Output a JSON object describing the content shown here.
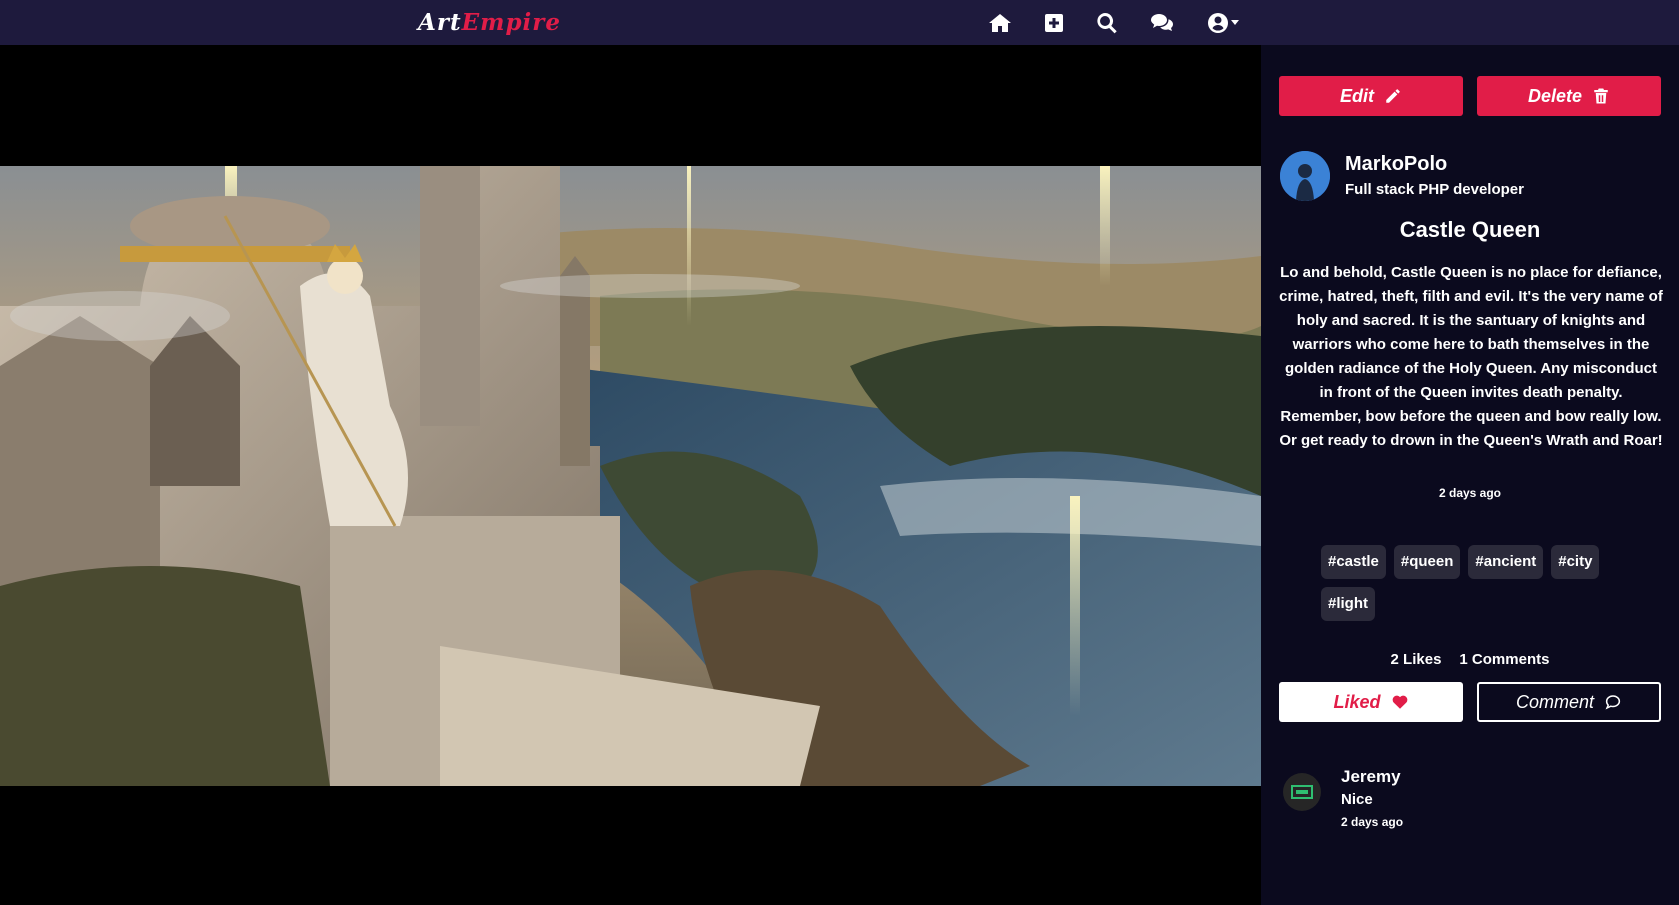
{
  "brand": {
    "part1": "Art",
    "part2": "Empire"
  },
  "nav": {
    "icons": [
      "home-icon",
      "add-post-icon",
      "search-icon",
      "chat-icon",
      "user-menu-icon"
    ]
  },
  "actions": {
    "edit_label": "Edit",
    "delete_label": "Delete"
  },
  "author": {
    "name": "MarkoPolo",
    "bio": "Full stack PHP developer"
  },
  "post": {
    "title": "Castle Queen",
    "description": "Lo and behold, Castle Queen is no place for defiance, crime, hatred, theft, filth and evil. It's the very name of holy and sacred. It is the santuary of knights and warriors who come here to bath themselves in the golden radiance of the Holy Queen. Any misconduct in front of the Queen invites death penalty. Remember, bow before the queen and bow really low. Or get ready to drown in the Queen's Wrath and Roar!",
    "time": "2 days ago",
    "tags": [
      "#castle",
      "#queen",
      "#ancient",
      "#city",
      "#light"
    ],
    "likes": "2 Likes",
    "comments": "1 Comments",
    "liked_label": "Liked",
    "comment_label": "Comment"
  },
  "comment": {
    "author": "Jeremy",
    "text": "Nice",
    "time": "2 days ago"
  },
  "colors": {
    "accent": "#e11d48",
    "navbar": "#1e1a3d",
    "panel": "#0b0a1e",
    "tag_bg": "#2b2a3a"
  }
}
